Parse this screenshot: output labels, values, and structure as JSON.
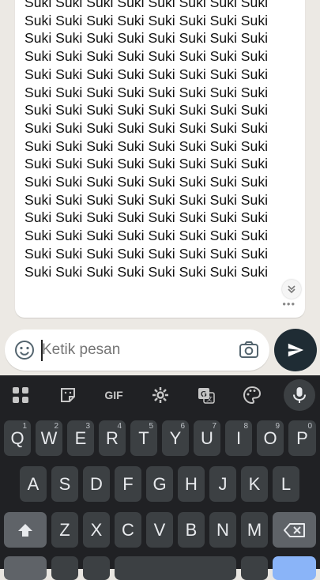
{
  "chat": {
    "message_text": "Suki Suki Suki Suki Suki Suki Suki Suki Suki Suki Suki Suki Suki Suki Suki Suki Suki Suki Suki Suki Suki Suki Suki Suki Suki Suki Suki Suki Suki Suki Suki Suki Suki Suki Suki Suki Suki Suki Suki Suki Suki Suki Suki Suki Suki Suki Suki Suki Suki Suki Suki Suki Suki Suki Suki Suki Suki Suki Suki Suki Suki Suki Suki Suki Suki Suki Suki Suki Suki Suki Suki Suki Suki Suki Suki Suki Suki Suki Suki Suki Suki Suki Suki Suki Suki Suki Suki Suki Suki Suki Suki Suki Suki Suki Suki Suki Suki Suki Suki Suki Suki Suki Suki Suki Suki Suki Suki Suki Suki Suki Suki Suki Suki Suki Suki Suki Suki Suki Suki Suki Suki Suki Suki Suki Suki Suki Suki Suki",
    "more_indicator": "•••",
    "expand_icon": "chevron-double-down-icon"
  },
  "composer": {
    "placeholder": "Ketik pesan",
    "emoji_icon": "emoji-icon",
    "camera_icon": "camera-icon",
    "send_icon": "send-icon"
  },
  "keyboard": {
    "toolbar": [
      "apps-icon",
      "sticker-icon",
      "GIF",
      "gear-icon",
      "translate-icon",
      "palette-icon",
      "mic-icon"
    ],
    "row1": [
      {
        "k": "Q",
        "h": "1"
      },
      {
        "k": "W",
        "h": "2"
      },
      {
        "k": "E",
        "h": "3"
      },
      {
        "k": "R",
        "h": "4"
      },
      {
        "k": "T",
        "h": "5"
      },
      {
        "k": "Y",
        "h": "6"
      },
      {
        "k": "U",
        "h": "7"
      },
      {
        "k": "I",
        "h": "8"
      },
      {
        "k": "O",
        "h": "9"
      },
      {
        "k": "P",
        "h": "0"
      }
    ],
    "row2": [
      "A",
      "S",
      "D",
      "F",
      "G",
      "H",
      "J",
      "K",
      "L"
    ],
    "row3": [
      "Z",
      "X",
      "C",
      "V",
      "B",
      "N",
      "M"
    ],
    "shift_icon": "shift-icon",
    "backspace_icon": "backspace-icon"
  }
}
